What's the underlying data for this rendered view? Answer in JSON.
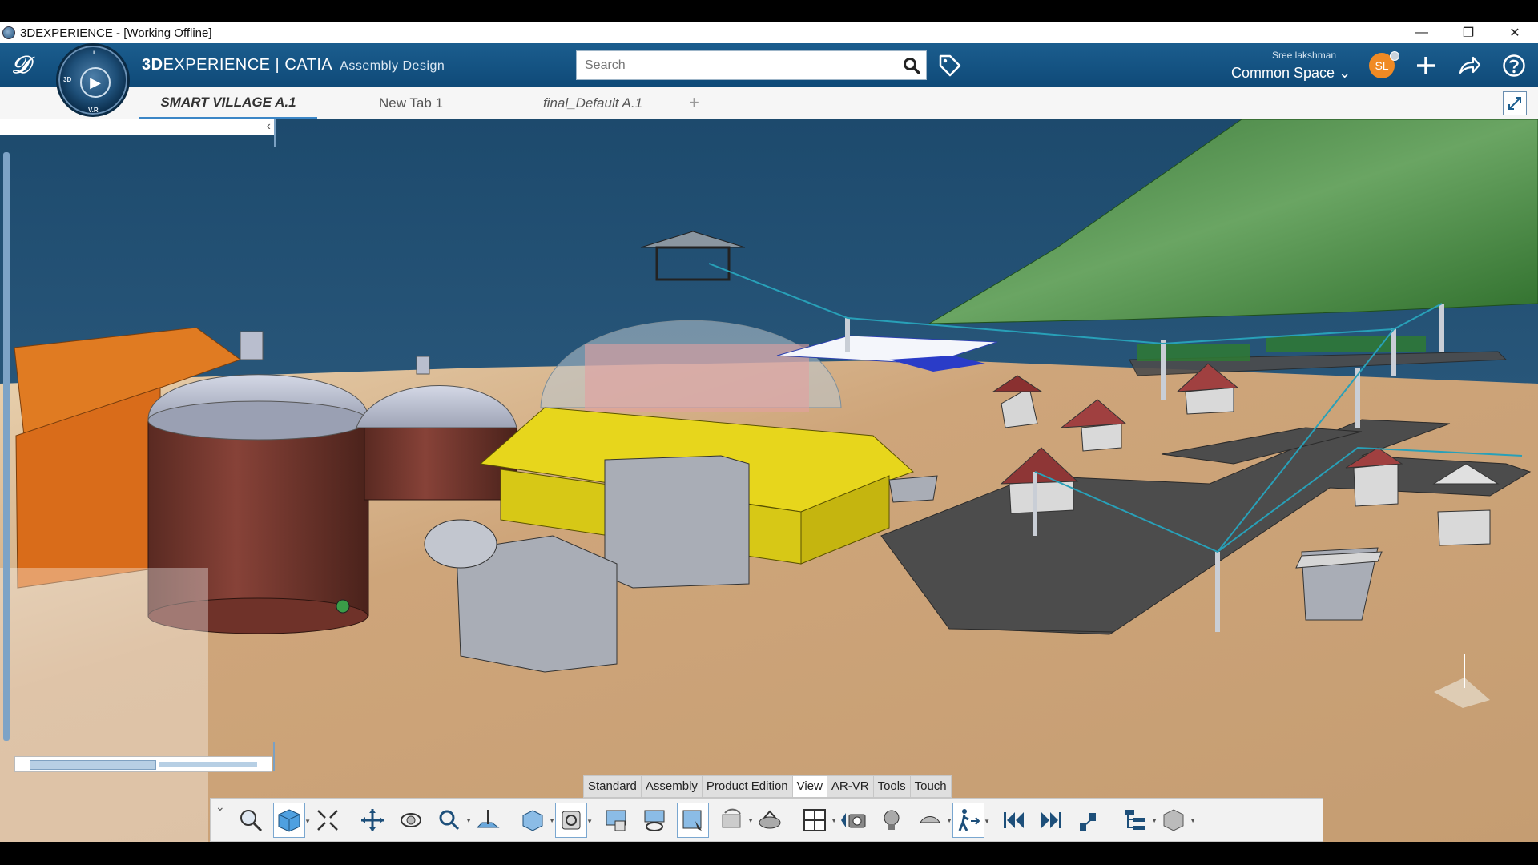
{
  "window": {
    "title": "3DEXPERIENCE - [Working Offline]",
    "controls": [
      "minimize",
      "restore",
      "close"
    ]
  },
  "header": {
    "brand_bold": "3D",
    "brand_rest": "EXPERIENCE | CATIA",
    "app_name": "Assembly Design",
    "compass_labels": [
      "3D",
      "V.R",
      "i"
    ],
    "search_placeholder": "Search",
    "user_name": "Sree lakshman",
    "space": "Common Space",
    "avatar_initials": "SL",
    "accent": "#0f4a78"
  },
  "tabs": [
    {
      "label": "SMART VILLAGE A.1",
      "active": true
    },
    {
      "label": "New Tab 1",
      "active": false
    },
    {
      "label": "final_Default A.1",
      "active": false
    }
  ],
  "tab_add": "+",
  "section_tabs": [
    {
      "label": "Standard",
      "active": false
    },
    {
      "label": "Assembly",
      "active": false
    },
    {
      "label": "Product Edition",
      "active": false
    },
    {
      "label": "View",
      "active": true
    },
    {
      "label": "AR-VR",
      "active": false
    },
    {
      "label": "Tools",
      "active": false
    },
    {
      "label": "Touch",
      "active": false
    }
  ],
  "toolbar_icons": [
    "zoom-fit-icon",
    "view-cube-icon",
    "fit-all-icon",
    "pan-icon",
    "rotate-icon",
    "zoom-icon",
    "normal-view-icon",
    "iso-view-icon",
    "render-style-icon",
    "hide-show-icon",
    "swap-visible-icon",
    "look-at-icon",
    "rotation-center-icon",
    "ground-icon",
    "multiview-icon",
    "capture-icon",
    "camera-icon",
    "light-icon",
    "fly-mode-icon",
    "walk-mode-icon",
    "first-icon",
    "last-icon",
    "step-icon",
    "tree-icon",
    "cube-icon"
  ]
}
